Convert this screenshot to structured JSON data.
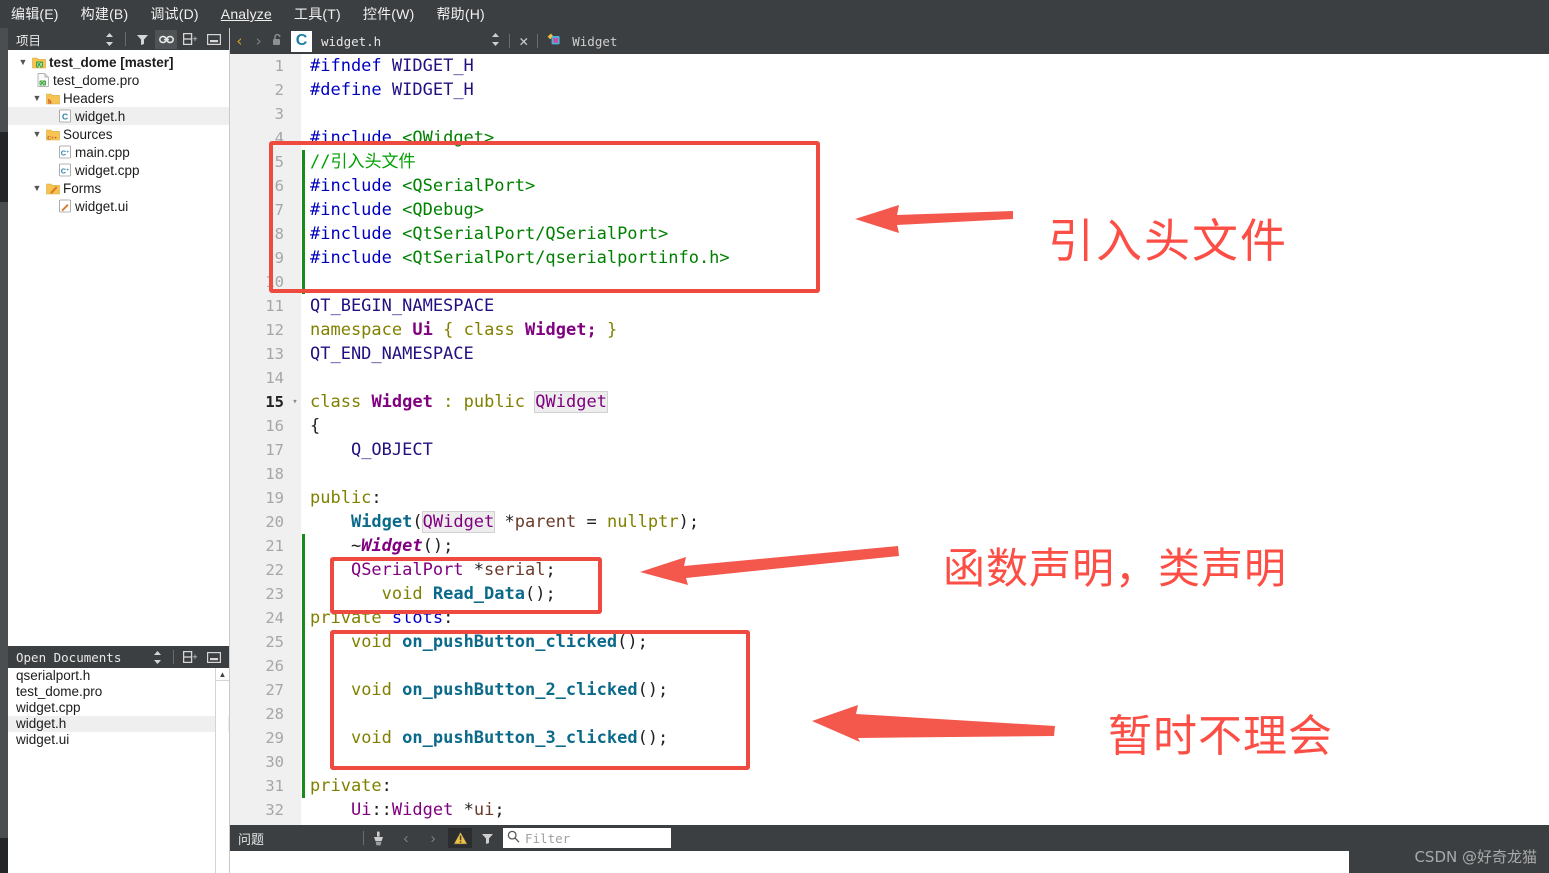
{
  "menubar": {
    "items": [
      {
        "label": "编辑(E)",
        "mnemonic": "E"
      },
      {
        "label": "构建(B)",
        "mnemonic": "B"
      },
      {
        "label": "调试(D)",
        "mnemonic": "D"
      },
      {
        "label": "Analyze",
        "mnemonic": "A"
      },
      {
        "label": "工具(T)",
        "mnemonic": "T"
      },
      {
        "label": "控件(W)",
        "mnemonic": "W"
      },
      {
        "label": "帮助(H)",
        "mnemonic": "H"
      }
    ]
  },
  "project_panel": {
    "title": "项目",
    "icons": [
      "sort-updown-icon",
      "filter-icon",
      "link-icon",
      "split-add-icon",
      "minimize-icon"
    ],
    "tree": [
      {
        "label": "test_dome [master]",
        "icon": "qt-project-icon",
        "indent": 0,
        "expander": "▼",
        "bold": true,
        "selected": false
      },
      {
        "label": "test_dome.pro",
        "icon": "qt-pro-file-icon",
        "indent": 1,
        "expander": "",
        "bold": false,
        "selected": false
      },
      {
        "label": "Headers",
        "icon": "headers-folder-icon",
        "indent": 1,
        "expander": "▼",
        "bold": false,
        "selected": false
      },
      {
        "label": "widget.h",
        "icon": "c-header-file-icon",
        "indent": 2,
        "expander": "",
        "bold": false,
        "selected": true
      },
      {
        "label": "Sources",
        "icon": "sources-folder-icon",
        "indent": 1,
        "expander": "▼",
        "bold": false,
        "selected": false
      },
      {
        "label": "main.cpp",
        "icon": "cpp-file-icon",
        "indent": 2,
        "expander": "",
        "bold": false,
        "selected": false
      },
      {
        "label": "widget.cpp",
        "icon": "cpp-file-icon",
        "indent": 2,
        "expander": "",
        "bold": false,
        "selected": false
      },
      {
        "label": "Forms",
        "icon": "forms-folder-icon",
        "indent": 1,
        "expander": "▼",
        "bold": false,
        "selected": false
      },
      {
        "label": "widget.ui",
        "icon": "ui-form-file-icon",
        "indent": 2,
        "expander": "",
        "bold": false,
        "selected": false
      }
    ]
  },
  "open_documents": {
    "title": "Open Documents",
    "icons": [
      "sort-updown-icon",
      "split-add-icon",
      "minimize-icon"
    ],
    "items": [
      {
        "label": "qserialport.h",
        "selected": false
      },
      {
        "label": "test_dome.pro",
        "selected": false
      },
      {
        "label": "widget.cpp",
        "selected": false
      },
      {
        "label": "widget.h",
        "selected": true
      },
      {
        "label": "widget.ui",
        "selected": false
      }
    ]
  },
  "editor_tabbar": {
    "back_icon": "chevron-left-icon",
    "forward_icon": "chevron-right-icon",
    "lock_icon": "unlocked-icon",
    "file_icon_letter": "C",
    "filename": "widget.h",
    "split_icon": "sort-updown-icon",
    "close_icon": "✕",
    "context_icon": "widget-class-icon",
    "context_label": "Widget"
  },
  "code": {
    "lines": [
      {
        "n": "1",
        "cur": false,
        "fold": "",
        "changed": false
      },
      {
        "n": "2",
        "cur": false,
        "fold": "",
        "changed": false
      },
      {
        "n": "3",
        "cur": false,
        "fold": "",
        "changed": false
      },
      {
        "n": "4",
        "cur": false,
        "fold": "",
        "changed": false
      },
      {
        "n": "5",
        "cur": false,
        "fold": "",
        "changed": true
      },
      {
        "n": "6",
        "cur": false,
        "fold": "",
        "changed": true
      },
      {
        "n": "7",
        "cur": false,
        "fold": "",
        "changed": true
      },
      {
        "n": "8",
        "cur": false,
        "fold": "",
        "changed": true
      },
      {
        "n": "9",
        "cur": false,
        "fold": "",
        "changed": true
      },
      {
        "n": "10",
        "cur": false,
        "fold": "",
        "changed": true
      },
      {
        "n": "11",
        "cur": false,
        "fold": "",
        "changed": false
      },
      {
        "n": "12",
        "cur": false,
        "fold": "",
        "changed": false
      },
      {
        "n": "13",
        "cur": false,
        "fold": "",
        "changed": false
      },
      {
        "n": "14",
        "cur": false,
        "fold": "",
        "changed": false
      },
      {
        "n": "15",
        "cur": true,
        "fold": "▾",
        "changed": false
      },
      {
        "n": "16",
        "cur": false,
        "fold": "",
        "changed": false
      },
      {
        "n": "17",
        "cur": false,
        "fold": "",
        "changed": false
      },
      {
        "n": "18",
        "cur": false,
        "fold": "",
        "changed": false
      },
      {
        "n": "19",
        "cur": false,
        "fold": "",
        "changed": false
      },
      {
        "n": "20",
        "cur": false,
        "fold": "",
        "changed": false
      },
      {
        "n": "21",
        "cur": false,
        "fold": "",
        "changed": true
      },
      {
        "n": "22",
        "cur": false,
        "fold": "",
        "changed": true
      },
      {
        "n": "23",
        "cur": false,
        "fold": "",
        "changed": true
      },
      {
        "n": "24",
        "cur": false,
        "fold": "",
        "changed": true
      },
      {
        "n": "25",
        "cur": false,
        "fold": "",
        "changed": true
      },
      {
        "n": "26",
        "cur": false,
        "fold": "",
        "changed": true
      },
      {
        "n": "27",
        "cur": false,
        "fold": "",
        "changed": true
      },
      {
        "n": "28",
        "cur": false,
        "fold": "",
        "changed": true
      },
      {
        "n": "29",
        "cur": false,
        "fold": "",
        "changed": true
      },
      {
        "n": "30",
        "cur": false,
        "fold": "",
        "changed": true
      },
      {
        "n": "31",
        "cur": false,
        "fold": "",
        "changed": true
      },
      {
        "n": "32",
        "cur": false,
        "fold": "",
        "changed": false
      }
    ],
    "text": [
      "#ifndef WIDGET_H",
      "#define WIDGET_H",
      "",
      "#include <QWidget>",
      "//引入头文件",
      "#include <QSerialPort>",
      "#include <QDebug>",
      "#include <QtSerialPort/QSerialPort>",
      "#include <QtSerialPort/qserialportinfo.h>",
      "",
      "QT_BEGIN_NAMESPACE",
      "namespace Ui { class Widget; }",
      "QT_END_NAMESPACE",
      "",
      "class Widget : public QWidget",
      "{",
      "    Q_OBJECT",
      "",
      "public:",
      "    Widget(QWidget *parent = nullptr);",
      "    ~Widget();",
      "    QSerialPort *serial;",
      "       void Read_Data();",
      "private slots:",
      "    void on_pushButton_clicked();",
      "",
      "    void on_pushButton_2_clicked();",
      "",
      "    void on_pushButton_3_clicked();",
      "",
      "private:",
      "    Ui::Widget *ui;"
    ]
  },
  "annotations": [
    {
      "text": "引入头文件",
      "arrow": "left-arrow-icon"
    },
    {
      "text": "函数声明，类声明",
      "arrow": "left-arrow-icon"
    },
    {
      "text": "暂时不理会",
      "arrow": "left-arrow-icon"
    }
  ],
  "bottombar": {
    "title": "问题",
    "icons": [
      "clear-issues-icon",
      "prev-issue-icon",
      "next-issue-icon",
      "warning-icon",
      "filter-icon"
    ],
    "filter_placeholder": "Filter",
    "search_icon": "search-icon"
  },
  "watermark": "CSDN @好奇龙猫",
  "colors": {
    "chrome": "#3c3f41",
    "annotation_red": "#fc4e45",
    "box_red": "#ef4a3f",
    "gutter": "#f0f0f0",
    "change_bar_green": "#1a8a1a",
    "keyword": "#808000",
    "preprocessor": "#0000c0",
    "comment": "#00a000",
    "string": "#008000",
    "type": "#800080",
    "function": "#0b6a8a"
  }
}
